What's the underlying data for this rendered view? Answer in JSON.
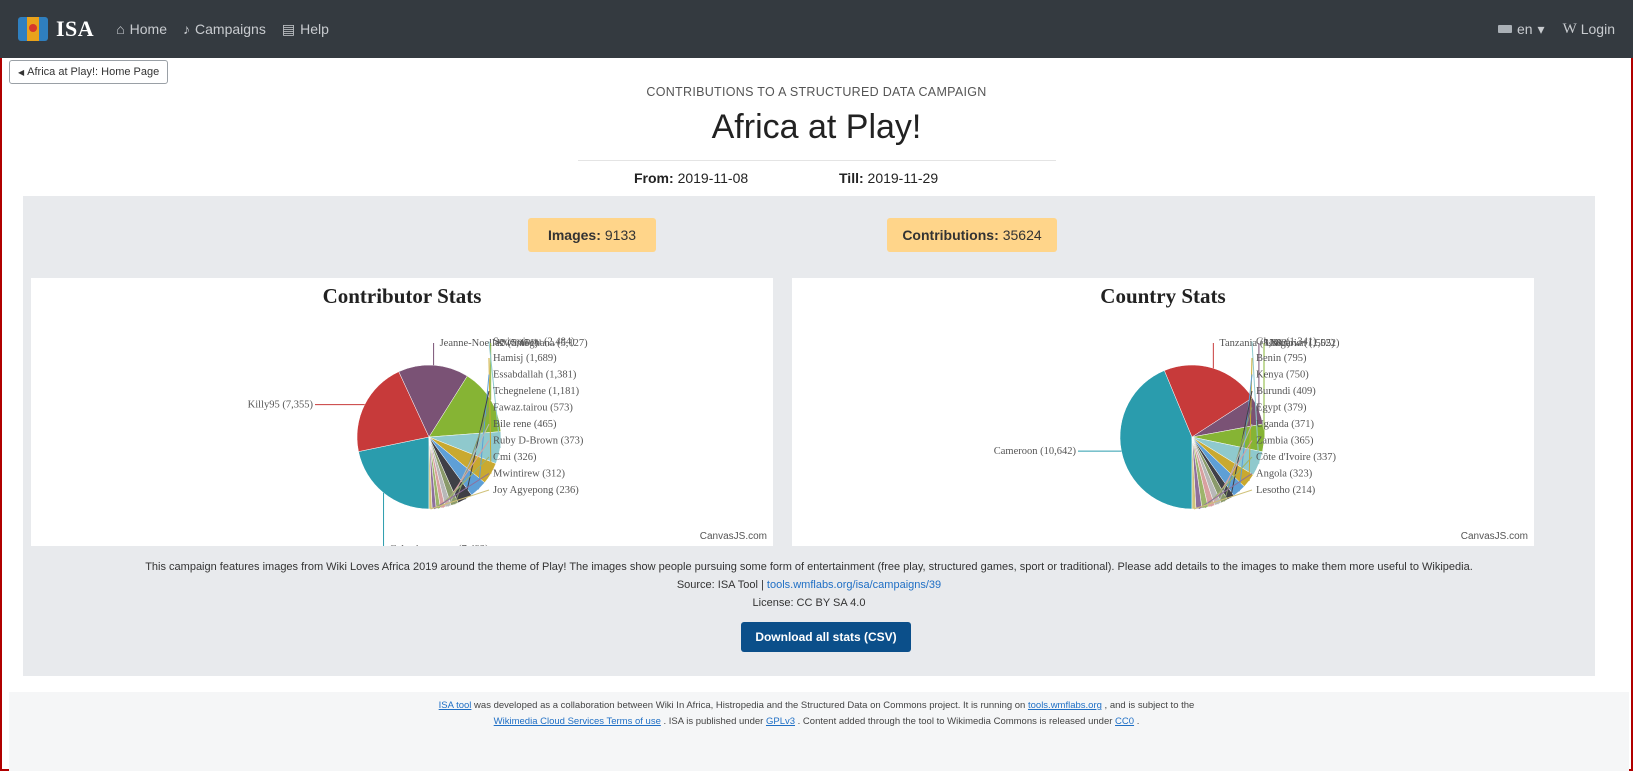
{
  "navbar": {
    "brand": "ISA",
    "links": [
      {
        "icon": "home-icon",
        "glyph": "⌂",
        "label": "Home"
      },
      {
        "icon": "bell-icon",
        "glyph": "♪",
        "label": "Campaigns"
      },
      {
        "icon": "book-icon",
        "glyph": "▤",
        "label": "Help"
      }
    ],
    "language": "en",
    "login_icon_text": "W",
    "login": "Login"
  },
  "back_button": "Africa at Play!: Home Page",
  "header": {
    "subtitle": "CONTRIBUTIONS TO A STRUCTURED DATA CAMPAIGN",
    "title": "Africa at Play!",
    "from_label": "From:",
    "from_value": "2019-11-08",
    "till_label": "Till:",
    "till_value": "2019-11-29"
  },
  "badges": {
    "images_label": "Images:",
    "images_value": "9133",
    "contributions_label": "Contributions:",
    "contributions_value": "35624"
  },
  "chart_data": [
    {
      "type": "pie",
      "title": "Contributor Stats",
      "credit": "CanvasJS.com",
      "slices": [
        {
          "label": "Celestinesucess",
          "value": 7492,
          "color": "#2a9cad"
        },
        {
          "label": "Killy95",
          "value": 7355,
          "color": "#c73a3a"
        },
        {
          "label": "Jeanne-Noelle2",
          "value": 5451,
          "color": "#7a5275"
        },
        {
          "label": "Kwameghana",
          "value": 5127,
          "color": "#86b434"
        },
        {
          "label": "Serieminou",
          "value": 2484,
          "color": "#8fc9cd"
        },
        {
          "label": "Hamisj",
          "value": 1689,
          "color": "#c9a930"
        },
        {
          "label": "Essabdallah",
          "value": 1381,
          "color": "#5e9fd6"
        },
        {
          "label": "Tchegnelene",
          "value": 1181,
          "color": "#3f3f46"
        },
        {
          "label": "Fawaz.tairou",
          "value": 573,
          "color": "#8a9a6a"
        },
        {
          "label": "Bile rene",
          "value": 465,
          "color": "#b8b8b8"
        },
        {
          "label": "Ruby D-Brown",
          "value": 373,
          "color": "#d8a0a0"
        },
        {
          "label": "Cmi",
          "value": 326,
          "color": "#9db46a"
        },
        {
          "label": "Mwintirew",
          "value": 312,
          "color": "#8e6f9c"
        },
        {
          "label": "Joy Agyepong",
          "value": 236,
          "color": "#d0c27a"
        }
      ]
    },
    {
      "type": "pie",
      "title": "Country Stats",
      "credit": "CanvasJS.com",
      "slices": [
        {
          "label": "Cameroon",
          "value": 10642,
          "color": "#2a9cad"
        },
        {
          "label": "Tanzania",
          "value": 5383,
          "color": "#c73a3a"
        },
        {
          "label": "Unknown",
          "value": 1522,
          "color": "#7a5275"
        },
        {
          "label": "Nigeria",
          "value": 1505,
          "color": "#86b434"
        },
        {
          "label": "Ghana",
          "value": 1341,
          "color": "#8fc9cd"
        },
        {
          "label": "Benin",
          "value": 795,
          "color": "#c9a930"
        },
        {
          "label": "Kenya",
          "value": 750,
          "color": "#5e9fd6"
        },
        {
          "label": "Burundi",
          "value": 409,
          "color": "#3f3f46"
        },
        {
          "label": "Egypt",
          "value": 379,
          "color": "#8a9a6a"
        },
        {
          "label": "Uganda",
          "value": 371,
          "color": "#b8b8b8"
        },
        {
          "label": "Zambia",
          "value": 365,
          "color": "#d8a0a0"
        },
        {
          "label": "Côte d'Ivoire",
          "value": 337,
          "color": "#9db46a"
        },
        {
          "label": "Angola",
          "value": 323,
          "color": "#8e6f9c"
        },
        {
          "label": "Lesotho",
          "value": 214,
          "color": "#d0c27a"
        }
      ]
    }
  ],
  "description": "This campaign features images from Wiki Loves Africa 2019 around the theme of Play! The images show people pursuing some form of entertainment (free play, structured games, sport or traditional). Please add details to the images to make them more useful to Wikipedia.",
  "source": {
    "label": "Source: ISA Tool |",
    "link": "tools.wmflabs.org/isa/campaigns/39"
  },
  "license": "License: CC BY SA 4.0",
  "download_button": "Download all stats (CSV)",
  "footer": {
    "isa_tool": "ISA tool",
    "text1": "was developed as a collaboration between Wiki In Africa, Histropedia and the Structured Data on Commons project. It is running on",
    "tools_link": "tools.wmflabs.org",
    "text2": ", and is subject to the",
    "terms_link": "Wikimedia Cloud Services Terms of use",
    "text3": ". ISA is published under",
    "gpl_link": "GPLv3",
    "text4": ". Content added through the tool to Wikimedia Commons is released under",
    "cc0_link": "CC0",
    "text5": "."
  }
}
